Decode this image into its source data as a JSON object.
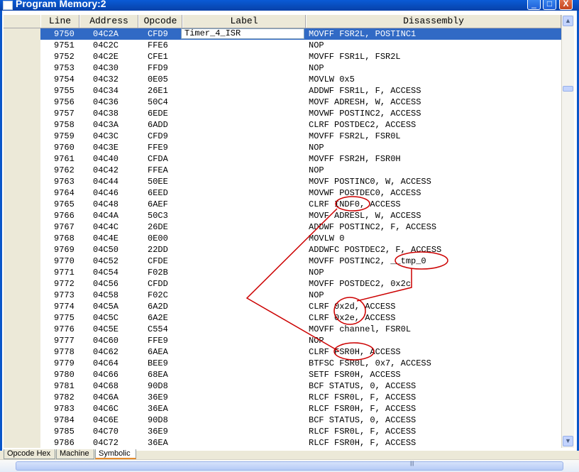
{
  "window": {
    "title": "Program Memory:2"
  },
  "columns": [
    "Line",
    "Address",
    "Opcode",
    "Label",
    "Disassembly"
  ],
  "selected_label_value": "Timer_4_ISR",
  "rows": [
    {
      "line": "9750",
      "address": "04C2A",
      "opcode": "CFD9",
      "label": "Timer_4_ISR",
      "dis": "MOVFF FSR2L, POSTINC1"
    },
    {
      "line": "9751",
      "address": "04C2C",
      "opcode": "FFE6",
      "label": "",
      "dis": "NOP"
    },
    {
      "line": "9752",
      "address": "04C2E",
      "opcode": "CFE1",
      "label": "",
      "dis": "MOVFF FSR1L, FSR2L"
    },
    {
      "line": "9753",
      "address": "04C30",
      "opcode": "FFD9",
      "label": "",
      "dis": "NOP"
    },
    {
      "line": "9754",
      "address": "04C32",
      "opcode": "0E05",
      "label": "",
      "dis": "MOVLW 0x5"
    },
    {
      "line": "9755",
      "address": "04C34",
      "opcode": "26E1",
      "label": "",
      "dis": "ADDWF FSR1L, F, ACCESS"
    },
    {
      "line": "9756",
      "address": "04C36",
      "opcode": "50C4",
      "label": "",
      "dis": "MOVF ADRESH, W, ACCESS"
    },
    {
      "line": "9757",
      "address": "04C38",
      "opcode": "6EDE",
      "label": "",
      "dis": "MOVWF POSTINC2, ACCESS"
    },
    {
      "line": "9758",
      "address": "04C3A",
      "opcode": "6ADD",
      "label": "",
      "dis": "CLRF POSTDEC2, ACCESS"
    },
    {
      "line": "9759",
      "address": "04C3C",
      "opcode": "CFD9",
      "label": "",
      "dis": "MOVFF FSR2L, FSR0L"
    },
    {
      "line": "9760",
      "address": "04C3E",
      "opcode": "FFE9",
      "label": "",
      "dis": "NOP"
    },
    {
      "line": "9761",
      "address": "04C40",
      "opcode": "CFDA",
      "label": "",
      "dis": "MOVFF FSR2H, FSR0H"
    },
    {
      "line": "9762",
      "address": "04C42",
      "opcode": "FFEA",
      "label": "",
      "dis": "NOP"
    },
    {
      "line": "9763",
      "address": "04C44",
      "opcode": "50EE",
      "label": "",
      "dis": "MOVF POSTINC0, W, ACCESS"
    },
    {
      "line": "9764",
      "address": "04C46",
      "opcode": "6EED",
      "label": "",
      "dis": "MOVWF POSTDEC0, ACCESS"
    },
    {
      "line": "9765",
      "address": "04C48",
      "opcode": "6AEF",
      "label": "",
      "dis": "CLRF INDF0, ACCESS"
    },
    {
      "line": "9766",
      "address": "04C4A",
      "opcode": "50C3",
      "label": "",
      "dis": "MOVF ADRESL, W, ACCESS"
    },
    {
      "line": "9767",
      "address": "04C4C",
      "opcode": "26DE",
      "label": "",
      "dis": "ADDWF POSTINC2, F, ACCESS"
    },
    {
      "line": "9768",
      "address": "04C4E",
      "opcode": "0E00",
      "label": "",
      "dis": "MOVLW 0"
    },
    {
      "line": "9769",
      "address": "04C50",
      "opcode": "22DD",
      "label": "",
      "dis": "ADDWFC POSTDEC2, F, ACCESS"
    },
    {
      "line": "9770",
      "address": "04C52",
      "opcode": "CFDE",
      "label": "",
      "dis": "MOVFF POSTINC2, __tmp_0"
    },
    {
      "line": "9771",
      "address": "04C54",
      "opcode": "F02B",
      "label": "",
      "dis": "NOP"
    },
    {
      "line": "9772",
      "address": "04C56",
      "opcode": "CFDD",
      "label": "",
      "dis": "MOVFF POSTDEC2, 0x2c"
    },
    {
      "line": "9773",
      "address": "04C58",
      "opcode": "F02C",
      "label": "",
      "dis": "NOP"
    },
    {
      "line": "9774",
      "address": "04C5A",
      "opcode": "6A2D",
      "label": "",
      "dis": "CLRF 0x2d, ACCESS"
    },
    {
      "line": "9775",
      "address": "04C5C",
      "opcode": "6A2E",
      "label": "",
      "dis": "CLRF 0x2e, ACCESS"
    },
    {
      "line": "9776",
      "address": "04C5E",
      "opcode": "C554",
      "label": "",
      "dis": "MOVFF channel, FSR0L"
    },
    {
      "line": "9777",
      "address": "04C60",
      "opcode": "FFE9",
      "label": "",
      "dis": "NOP"
    },
    {
      "line": "9778",
      "address": "04C62",
      "opcode": "6AEA",
      "label": "",
      "dis": "CLRF FSR0H, ACCESS"
    },
    {
      "line": "9779",
      "address": "04C64",
      "opcode": "BEE9",
      "label": "",
      "dis": "BTFSC FSR0L, 0x7, ACCESS"
    },
    {
      "line": "9780",
      "address": "04C66",
      "opcode": "68EA",
      "label": "",
      "dis": "SETF FSR0H, ACCESS"
    },
    {
      "line": "9781",
      "address": "04C68",
      "opcode": "90D8",
      "label": "",
      "dis": "BCF STATUS, 0, ACCESS"
    },
    {
      "line": "9782",
      "address": "04C6A",
      "opcode": "36E9",
      "label": "",
      "dis": "RLCF FSR0L, F, ACCESS"
    },
    {
      "line": "9783",
      "address": "04C6C",
      "opcode": "36EA",
      "label": "",
      "dis": "RLCF FSR0H, F, ACCESS"
    },
    {
      "line": "9784",
      "address": "04C6E",
      "opcode": "90D8",
      "label": "",
      "dis": "BCF STATUS, 0, ACCESS"
    },
    {
      "line": "9785",
      "address": "04C70",
      "opcode": "36E9",
      "label": "",
      "dis": "RLCF FSR0L, F, ACCESS"
    },
    {
      "line": "9786",
      "address": "04C72",
      "opcode": "36EA",
      "label": "",
      "dis": "RLCF FSR0H, F, ACCESS"
    }
  ],
  "tabs": [
    {
      "label": "Opcode Hex",
      "active": false
    },
    {
      "label": "Machine",
      "active": false
    },
    {
      "label": "Symbolic",
      "active": true
    }
  ],
  "window_buttons": {
    "minimize": "_",
    "maximize": "□",
    "close": "X"
  },
  "icons": {
    "up": "scroll-up-icon",
    "down": "scroll-down-icon"
  },
  "colors": {
    "selection": "#316ac5",
    "annotation": "#cc0000",
    "titlebar": "#0a5bd6"
  }
}
